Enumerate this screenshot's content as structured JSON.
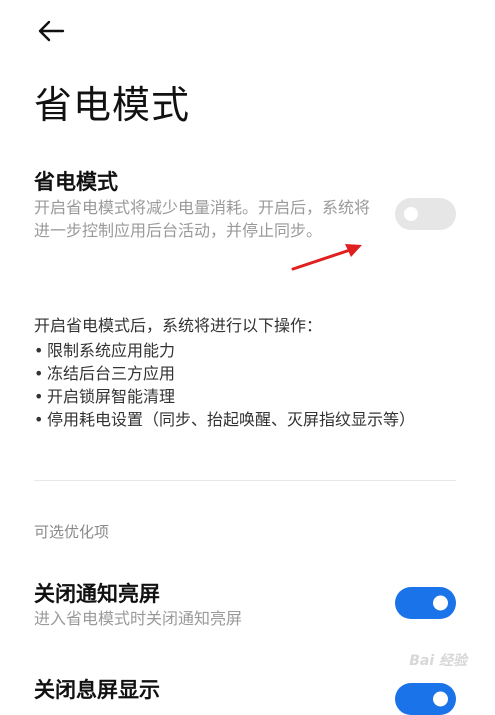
{
  "page": {
    "title": "省电模式"
  },
  "power_saving": {
    "title": "省电模式",
    "description": "开启省电模式将减少电量消耗。开启后，系统将进一步控制应用后台活动，并停止同步。",
    "enabled": false
  },
  "info": {
    "intro": "开启省电模式后，系统将进行以下操作：",
    "items": [
      "限制系统应用能力",
      "冻结后台三方应用",
      "开启锁屏智能清理",
      "停用耗电设置（同步、抬起唤醒、灭屏指纹显示等）"
    ]
  },
  "optional_section": {
    "header": "可选优化项"
  },
  "options": [
    {
      "title": "关闭通知亮屏",
      "description": "进入省电模式时关闭通知亮屏",
      "enabled": true
    },
    {
      "title": "关闭息屏显示",
      "enabled": true
    }
  ],
  "colors": {
    "toggle_on": "#1a73e8",
    "toggle_off": "#e6e6e6",
    "annotation_arrow": "#e02020"
  },
  "icons": {
    "back": "arrow-left-icon",
    "bullet": "•"
  },
  "watermark": "Bai 经验"
}
